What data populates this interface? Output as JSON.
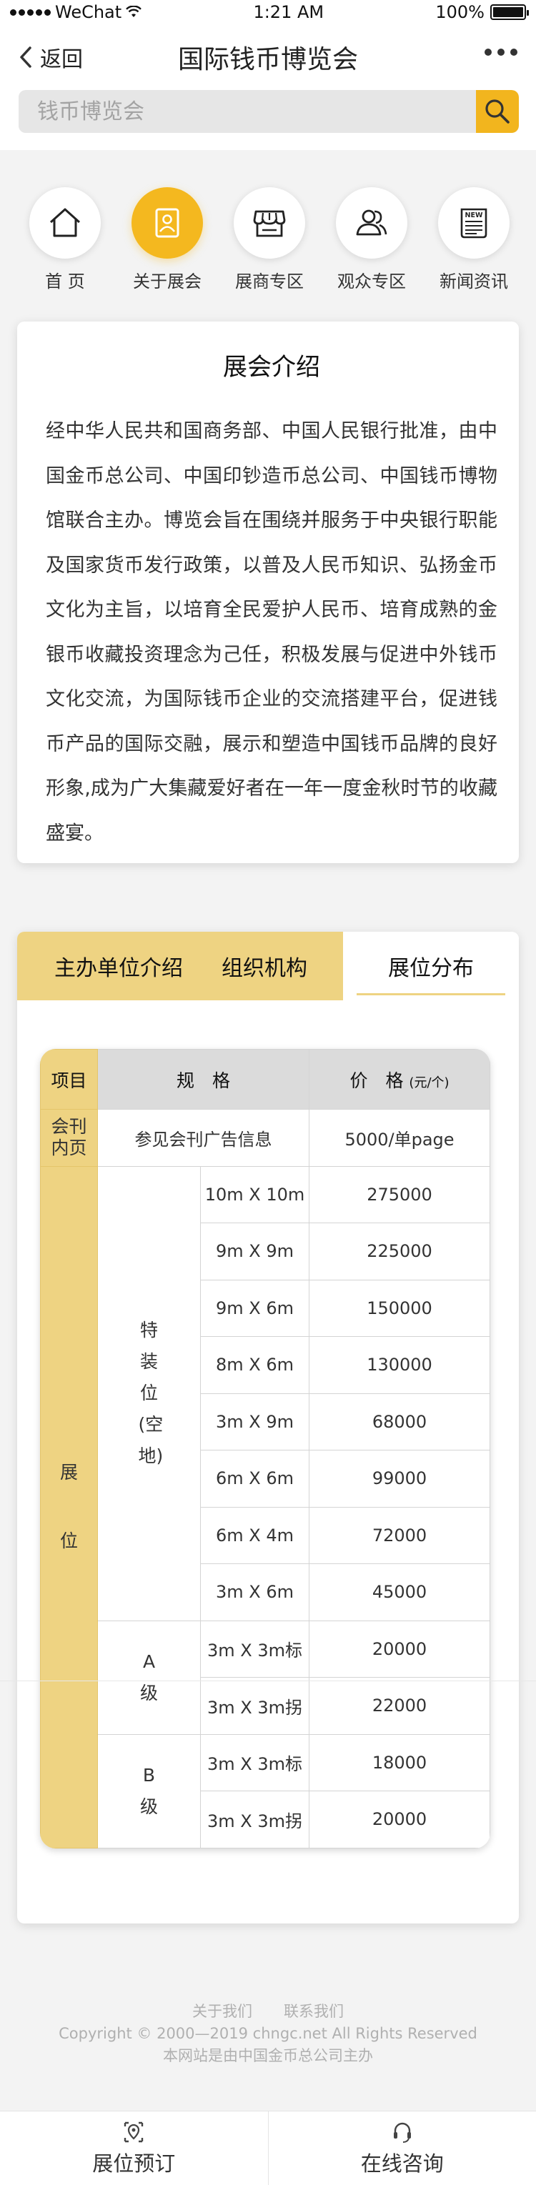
{
  "status_bar": {
    "carrier": "WeChat",
    "time": "1:21 AM",
    "battery": "100%"
  },
  "nav": {
    "back_label": "返回",
    "title": "国际钱币博览会"
  },
  "search": {
    "placeholder": "钱币博览会"
  },
  "icon_nav": [
    {
      "label": "首 页",
      "icon": "home-icon",
      "active": false
    },
    {
      "label": "关于展会",
      "icon": "badge-icon",
      "active": true
    },
    {
      "label": "展商专区",
      "icon": "store-icon",
      "active": false
    },
    {
      "label": "观众专区",
      "icon": "users-icon",
      "active": false
    },
    {
      "label": "新闻资讯",
      "icon": "news-icon",
      "active": false
    }
  ],
  "intro": {
    "title": "展会介绍",
    "body": "经中华人民共和国商务部、中国人民银行批准，由中国金币总公司、中国印钞造币总公司、中国钱币博物馆联合主办。博览会旨在围绕并服务于中央银行职能及国家货币发行政策，以普及人民币知识、弘扬金币文化为主旨，以培育全民爱护人民币、培育成熟的金银币收藏投资理念为己任，积极发展与促进中外钱币文化交流，为国际钱币企业的交流搭建平台，促进钱币产品的国际交融，展示和塑造中国钱币品牌的良好形象,成为广大集藏爱好者在一年一度金秋时节的收藏盛宴。"
  },
  "tabs": [
    {
      "label": "主办单位介绍",
      "active": false
    },
    {
      "label": "组织机构",
      "active": false
    },
    {
      "label": "展位分布",
      "active": true
    }
  ],
  "table": {
    "headers": {
      "item": "项目",
      "spec": "规　格",
      "price": "价　格",
      "price_unit": "(元/个)"
    },
    "journal": {
      "item": "会刊内页",
      "spec": "参见会刊广告信息",
      "price": "5000/单page"
    },
    "booth_label": "展位",
    "special": {
      "label": "特装位(空地)",
      "rows": [
        {
          "size": "10m X 10m",
          "price": "275000"
        },
        {
          "size": "9m X 9m",
          "price": "225000"
        },
        {
          "size": "9m X 6m",
          "price": "150000"
        },
        {
          "size": "8m X 6m",
          "price": "130000"
        },
        {
          "size": "3m X 9m",
          "price": "68000"
        },
        {
          "size": "6m X 6m",
          "price": "99000"
        },
        {
          "size": "6m X 4m",
          "price": "72000"
        },
        {
          "size": "3m X 6m",
          "price": "45000"
        }
      ]
    },
    "grade_a": {
      "label": "A级",
      "rows": [
        {
          "size": "3m X 3m标",
          "price": "20000"
        },
        {
          "size": "3m X 3m拐",
          "price": "22000"
        }
      ]
    },
    "grade_b": {
      "label": "B级",
      "rows": [
        {
          "size": "3m X 3m标",
          "price": "18000"
        },
        {
          "size": "3m X 3m拐",
          "price": "20000"
        }
      ]
    }
  },
  "footer": {
    "about": "关于我们",
    "contact": "联系我们",
    "copyright": "Copyright © 2000—2019 chngc.net All Rights Reserved",
    "note": "本网站是由中国金币总公司主办"
  },
  "bottom_bar": {
    "booking": "展位预订",
    "consult": "在线咨询"
  },
  "colors": {
    "accent": "#f4b81f",
    "tab_yellow": "#eed382"
  }
}
